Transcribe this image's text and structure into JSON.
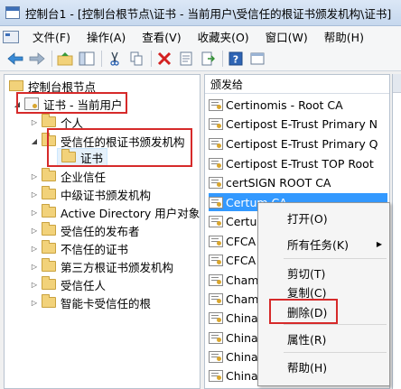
{
  "window": {
    "title": "控制台1 - [控制台根节点\\证书 - 当前用户\\受信任的根证书颁发机构\\证书]"
  },
  "menu": [
    "文件(F)",
    "操作(A)",
    "查看(V)",
    "收藏夹(O)",
    "窗口(W)",
    "帮助(H)"
  ],
  "toolbar": {
    "icons": [
      "back-arrow-icon",
      "forward-arrow-icon",
      "up-folder-icon",
      "show-hide-tree-icon",
      "cut-icon",
      "copy-icon",
      "delete-icon",
      "properties-icon",
      "export-icon",
      "help-icon",
      "console-view-icon"
    ]
  },
  "tree": {
    "root": "控制台根节点",
    "store": "证书 - 当前用户",
    "items": [
      "个人",
      "受信任的根证书颁发机构",
      "证书",
      "企业信任",
      "中级证书颁发机构",
      "Active Directory 用户对象",
      "受信任的发布者",
      "不信任的证书",
      "第三方根证书颁发机构",
      "受信任人",
      "智能卡受信任的根"
    ]
  },
  "list": {
    "column_header": "颁发给",
    "rows": [
      "Certinomis - Root CA",
      "Certipost E-Trust Primary N",
      "Certipost E-Trust Primary Q",
      "Certipost E-Trust TOP Root",
      "certSIGN ROOT CA",
      "Certum CA",
      "Certum",
      "CFCA",
      "CFCA",
      "Cham",
      "Cham",
      "China",
      "China",
      "China",
      "China"
    ],
    "selected_index": 5
  },
  "context_menu": {
    "items": [
      "打开(O)",
      "所有任务(K)",
      "剪切(T)",
      "复制(C)",
      "删除(D)",
      "属性(R)",
      "帮助(H)"
    ]
  },
  "colors": {
    "selection": "#3399ff",
    "highlight_box": "#d62a2a"
  }
}
